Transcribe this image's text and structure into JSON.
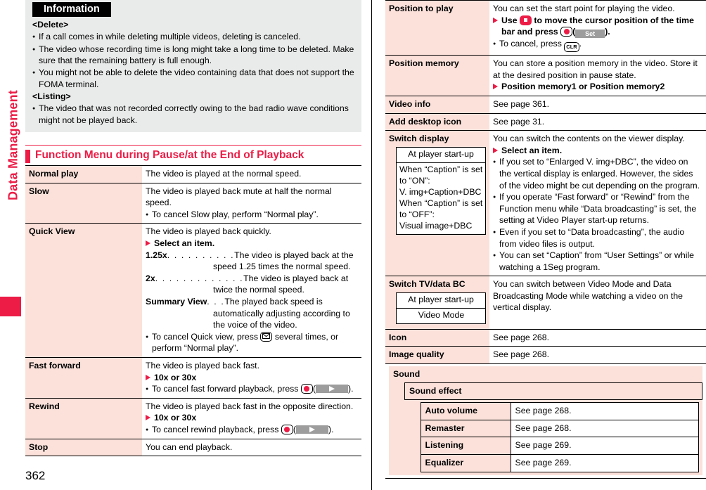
{
  "sidebar": {
    "label": "Data Management"
  },
  "page_number": "362",
  "information": {
    "title": "Information",
    "blocks": [
      {
        "heading": "<Delete>",
        "bullets": [
          "If a call comes in while deleting multiple videos, deleting is canceled.",
          "The video whose recording time is long might take a long time to be deleted. Make sure that the remaining battery is full enough.",
          "You might not be able to delete the video containing data that does not support the FOMA terminal."
        ]
      },
      {
        "heading": "<Listing>",
        "bullets": [
          "The video that was not recorded correctly owing to the bad radio wave conditions might not be played back."
        ]
      }
    ]
  },
  "section": {
    "title": "Function Menu during Pause/at the End of Playback"
  },
  "left_table": {
    "normal_play": {
      "term": "Normal play",
      "desc": "The video is played at the normal speed."
    },
    "slow": {
      "term": "Slow",
      "desc": "The video is played back mute at half the normal speed.",
      "bullet": "To cancel Slow play, perform “Normal play”."
    },
    "quick_view": {
      "term": "Quick View",
      "desc": "The video is played back quickly.",
      "arrow": "Select an item.",
      "items": [
        {
          "label": "1.25x",
          "dots": ". . . . . . . . . .",
          "text": "The video is played back at the speed 1.25 times the normal speed."
        },
        {
          "label": "2x",
          "dots": ". . . . . . . . . . . . .",
          "text": "The video is played back at twice the normal speed."
        },
        {
          "label": "Summary View",
          "dots": ". . .",
          "text": "The played back speed is automatically adjusting according to the voice of the video."
        }
      ],
      "bullet_pre": "To cancel Quick view, press",
      "bullet_key": "mail-key",
      "bullet_post": "several times, or perform “Normal play”."
    },
    "fast_forward": {
      "term": "Fast forward",
      "desc": "The video is played back fast.",
      "arrow": "10x or 30x",
      "bullet_pre": "To cancel fast forward playback, press",
      "bullet_post": ")."
    },
    "rewind": {
      "term": "Rewind",
      "desc": "The video is played back fast in the opposite direction.",
      "arrow": "10x or 30x",
      "bullet_pre": "To cancel rewind playback, press",
      "bullet_post": ")."
    },
    "stop": {
      "term": "Stop",
      "desc": "You can end playback."
    }
  },
  "right_table": {
    "position_to_play": {
      "term": "Position to play",
      "desc": "You can set the start point for playing the video.",
      "arrow_pre": "Use",
      "arrow_mid": "to move the cursor position of the time bar and press",
      "softkey": "Set",
      "arrow_post": ").",
      "bullet_pre": "To cancel, press",
      "clr_key": "CLR",
      "bullet_post": "."
    },
    "position_memory": {
      "term": "Position memory",
      "desc": "You can store a position memory in the video. Store it at the desired position in pause state.",
      "arrow": "Position memory1 or Position memory2"
    },
    "video_info": {
      "term": "Video info",
      "desc": "See page 361."
    },
    "add_desktop_icon": {
      "term": "Add desktop icon",
      "desc": "See page 31."
    },
    "switch_display": {
      "term": "Switch display",
      "mini_head": "At player start-up",
      "mini_body": "When “Caption” is set to “ON”:\nV. img+Caption+DBC\nWhen “Caption” is set to “OFF”:\nVisual image+DBC",
      "desc": "You can switch the contents on the viewer display.",
      "arrow": "Select an item.",
      "bullets": [
        "If you set to “Enlarged V. img+DBC”, the video on the vertical display is enlarged. However, the sides of the video might be cut depending on the program.",
        "If you operate “Fast forward” or “Rewind” from the Function menu while “Data broadcasting” is set, the setting at Video Player start-up returns.",
        "Even if you set to “Data broadcasting”, the audio from video files is output.",
        "You can set “Caption” from “User Settings” or while watching a 1Seg program."
      ]
    },
    "switch_tv_data_bc": {
      "term": "Switch TV/data BC",
      "mini_head": "At player start-up",
      "mini_body": "Video Mode",
      "desc": "You can switch between Video Mode and Data Broadcasting Mode while watching a video on the vertical display."
    },
    "icon": {
      "term": "Icon",
      "desc": "See page 268."
    },
    "image_quality": {
      "term": "Image quality",
      "desc": "See page 268."
    },
    "sound": {
      "term": "Sound",
      "group": "Sound effect",
      "rows": [
        {
          "term": "Auto volume",
          "desc": "See page 268."
        },
        {
          "term": "Remaster",
          "desc": "See page 268."
        },
        {
          "term": "Listening",
          "desc": "See page 269."
        },
        {
          "term": "Equalizer",
          "desc": "See page 269."
        }
      ]
    }
  },
  "colors": {
    "accent": "#ec1c46",
    "term_bg": "#fbe1da",
    "info_bg": "#e9eaea"
  }
}
